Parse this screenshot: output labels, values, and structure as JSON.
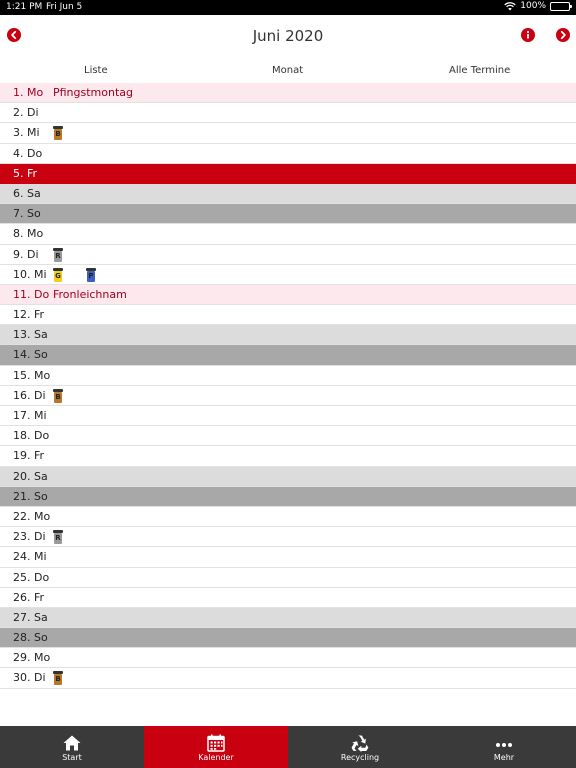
{
  "status": {
    "time": "1:21 PM",
    "date": "Fri Jun 5",
    "battery": "100%"
  },
  "header": {
    "title": "Juni 2020",
    "prev_icon": "chevron-left-icon",
    "info_icon": "info-icon",
    "next_icon": "chevron-right-icon"
  },
  "view_tabs": [
    "Liste",
    "Monat",
    "Alle Termine"
  ],
  "days": [
    {
      "label": "1. Mo",
      "type": "holiday",
      "holiday": "Pfingstmontag",
      "bins": []
    },
    {
      "label": "2. Di",
      "type": "weekday",
      "holiday": "",
      "bins": []
    },
    {
      "label": "3. Mi",
      "type": "weekday",
      "holiday": "",
      "bins": [
        {
          "kind": "bio-bin-icon",
          "letter": "B",
          "color": "#b8772a"
        }
      ]
    },
    {
      "label": "4. Do",
      "type": "weekday",
      "holiday": "",
      "bins": []
    },
    {
      "label": "5. Fr",
      "type": "today",
      "holiday": "",
      "bins": []
    },
    {
      "label": "6. Sa",
      "type": "sat",
      "holiday": "",
      "bins": []
    },
    {
      "label": "7. So",
      "type": "sun",
      "holiday": "",
      "bins": []
    },
    {
      "label": "8. Mo",
      "type": "weekday",
      "holiday": "",
      "bins": []
    },
    {
      "label": "9. Di",
      "type": "weekday",
      "holiday": "",
      "bins": [
        {
          "kind": "residual-bin-icon",
          "letter": "R",
          "color": "#9a9a9a"
        }
      ]
    },
    {
      "label": "10. Mi",
      "type": "weekday",
      "holiday": "",
      "bins": [
        {
          "kind": "yellow-bin-icon",
          "letter": "G",
          "color": "#f0cf1a"
        },
        {
          "kind": "paper-bin-icon",
          "letter": "P",
          "color": "#3d5fc4"
        }
      ]
    },
    {
      "label": "11. Do",
      "type": "holiday",
      "holiday": "Fronleichnam",
      "bins": []
    },
    {
      "label": "12. Fr",
      "type": "weekday",
      "holiday": "",
      "bins": []
    },
    {
      "label": "13. Sa",
      "type": "sat",
      "holiday": "",
      "bins": []
    },
    {
      "label": "14. So",
      "type": "sun",
      "holiday": "",
      "bins": []
    },
    {
      "label": "15. Mo",
      "type": "weekday",
      "holiday": "",
      "bins": []
    },
    {
      "label": "16. Di",
      "type": "weekday",
      "holiday": "",
      "bins": [
        {
          "kind": "bio-bin-icon",
          "letter": "B",
          "color": "#b8772a"
        }
      ]
    },
    {
      "label": "17. Mi",
      "type": "weekday",
      "holiday": "",
      "bins": []
    },
    {
      "label": "18. Do",
      "type": "weekday",
      "holiday": "",
      "bins": []
    },
    {
      "label": "19. Fr",
      "type": "weekday",
      "holiday": "",
      "bins": []
    },
    {
      "label": "20. Sa",
      "type": "sat",
      "holiday": "",
      "bins": []
    },
    {
      "label": "21. So",
      "type": "sun",
      "holiday": "",
      "bins": []
    },
    {
      "label": "22. Mo",
      "type": "weekday",
      "holiday": "",
      "bins": []
    },
    {
      "label": "23. Di",
      "type": "weekday",
      "holiday": "",
      "bins": [
        {
          "kind": "residual-bin-icon",
          "letter": "R",
          "color": "#9a9a9a"
        }
      ]
    },
    {
      "label": "24. Mi",
      "type": "weekday",
      "holiday": "",
      "bins": []
    },
    {
      "label": "25. Do",
      "type": "weekday",
      "holiday": "",
      "bins": []
    },
    {
      "label": "26. Fr",
      "type": "weekday",
      "holiday": "",
      "bins": []
    },
    {
      "label": "27. Sa",
      "type": "sat",
      "holiday": "",
      "bins": []
    },
    {
      "label": "28. So",
      "type": "sun",
      "holiday": "",
      "bins": []
    },
    {
      "label": "29. Mo",
      "type": "weekday",
      "holiday": "",
      "bins": []
    },
    {
      "label": "30. Di",
      "type": "weekday",
      "holiday": "",
      "bins": [
        {
          "kind": "bio-bin-icon",
          "letter": "B",
          "color": "#b8772a"
        }
      ]
    }
  ],
  "tabbar": [
    {
      "label": "Start",
      "icon": "home-icon",
      "active": false
    },
    {
      "label": "Kalender",
      "icon": "calendar-icon",
      "active": true
    },
    {
      "label": "Recycling",
      "icon": "recycle-icon",
      "active": false
    },
    {
      "label": "Mehr",
      "icon": "more-icon",
      "active": false
    }
  ],
  "colors": {
    "accent": "#c8000f",
    "holiday_bg": "#fde8ed",
    "saturday_bg": "#dcdcdc",
    "sunday_bg": "#a8a8a8",
    "tabbar_bg": "#3a3a3a"
  }
}
